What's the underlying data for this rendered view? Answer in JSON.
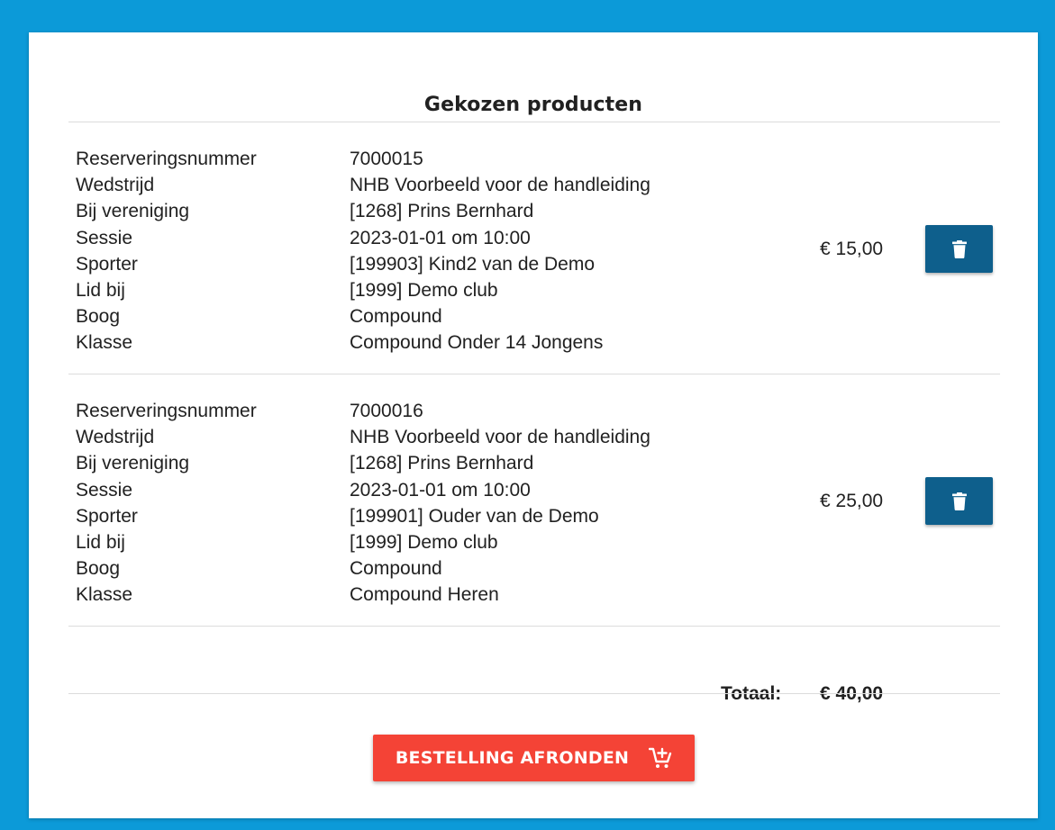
{
  "page": {
    "title": "Gekozen producten"
  },
  "labels": {
    "reservering": "Reserveringsnummer",
    "wedstrijd": "Wedstrijd",
    "vereniging": "Bij vereniging",
    "sessie": "Sessie",
    "sporter": "Sporter",
    "lid_bij": "Lid bij",
    "boog": "Boog",
    "klasse": "Klasse"
  },
  "products": [
    {
      "reservering": "7000015",
      "wedstrijd": "NHB Voorbeeld voor de handleiding",
      "vereniging": "[1268] Prins Bernhard",
      "sessie": "2023-01-01 om 10:00",
      "sporter": "[199903] Kind2 van de Demo",
      "lid_bij": "[1999] Demo club",
      "boog": "Compound",
      "klasse": "Compound Onder 14 Jongens",
      "price": "€ 15,00",
      "delete_icon": "trash-icon"
    },
    {
      "reservering": "7000016",
      "wedstrijd": "NHB Voorbeeld voor de handleiding",
      "vereniging": "[1268] Prins Bernhard",
      "sessie": "2023-01-01 om 10:00",
      "sporter": "[199901] Ouder van de Demo",
      "lid_bij": "[1999] Demo club",
      "boog": "Compound",
      "klasse": "Compound Heren",
      "price": "€ 25,00",
      "delete_icon": "trash-icon"
    }
  ],
  "totals": {
    "label": "Totaal:",
    "value": "€ 40,00"
  },
  "actions": {
    "order_label": "BESTELLING AFRONDEN",
    "order_icon": "cart-add-icon"
  },
  "colors": {
    "background": "#0c9ad8",
    "delete_button": "#0e5f8c",
    "order_button": "#f44336"
  }
}
